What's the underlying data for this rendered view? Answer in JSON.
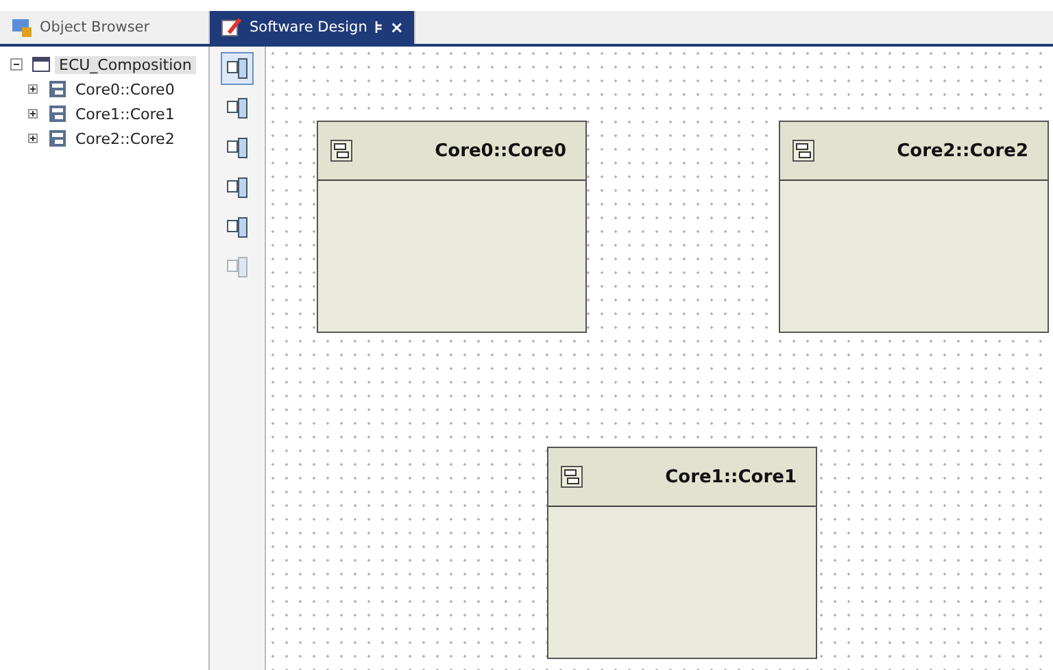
{
  "tabs": [
    {
      "label": "Object Browser",
      "selected": false
    },
    {
      "label": "Software Design",
      "selected": true,
      "pin": "⊧",
      "close": "×"
    }
  ],
  "tree": [
    {
      "label": "ECU_Composition",
      "selected": true,
      "expanded": true,
      "children": [
        {
          "label": "Core0::Core0",
          "selected": false,
          "expanded": false
        },
        {
          "label": "Core1::Core1",
          "selected": false,
          "expanded": false
        },
        {
          "label": "Core2::Core2",
          "selected": false,
          "expanded": false
        }
      ]
    }
  ],
  "toolbar": [
    {
      "selected": true,
      "disabled": false
    },
    {
      "selected": false,
      "disabled": false
    },
    {
      "selected": false,
      "disabled": false
    },
    {
      "selected": false,
      "disabled": false
    },
    {
      "selected": false,
      "disabled": false
    },
    {
      "selected": false,
      "disabled": true
    }
  ],
  "components": [
    {
      "title": "Core0::Core0"
    },
    {
      "title": "Core2::Core2"
    },
    {
      "title": "Core1::Core1"
    }
  ]
}
